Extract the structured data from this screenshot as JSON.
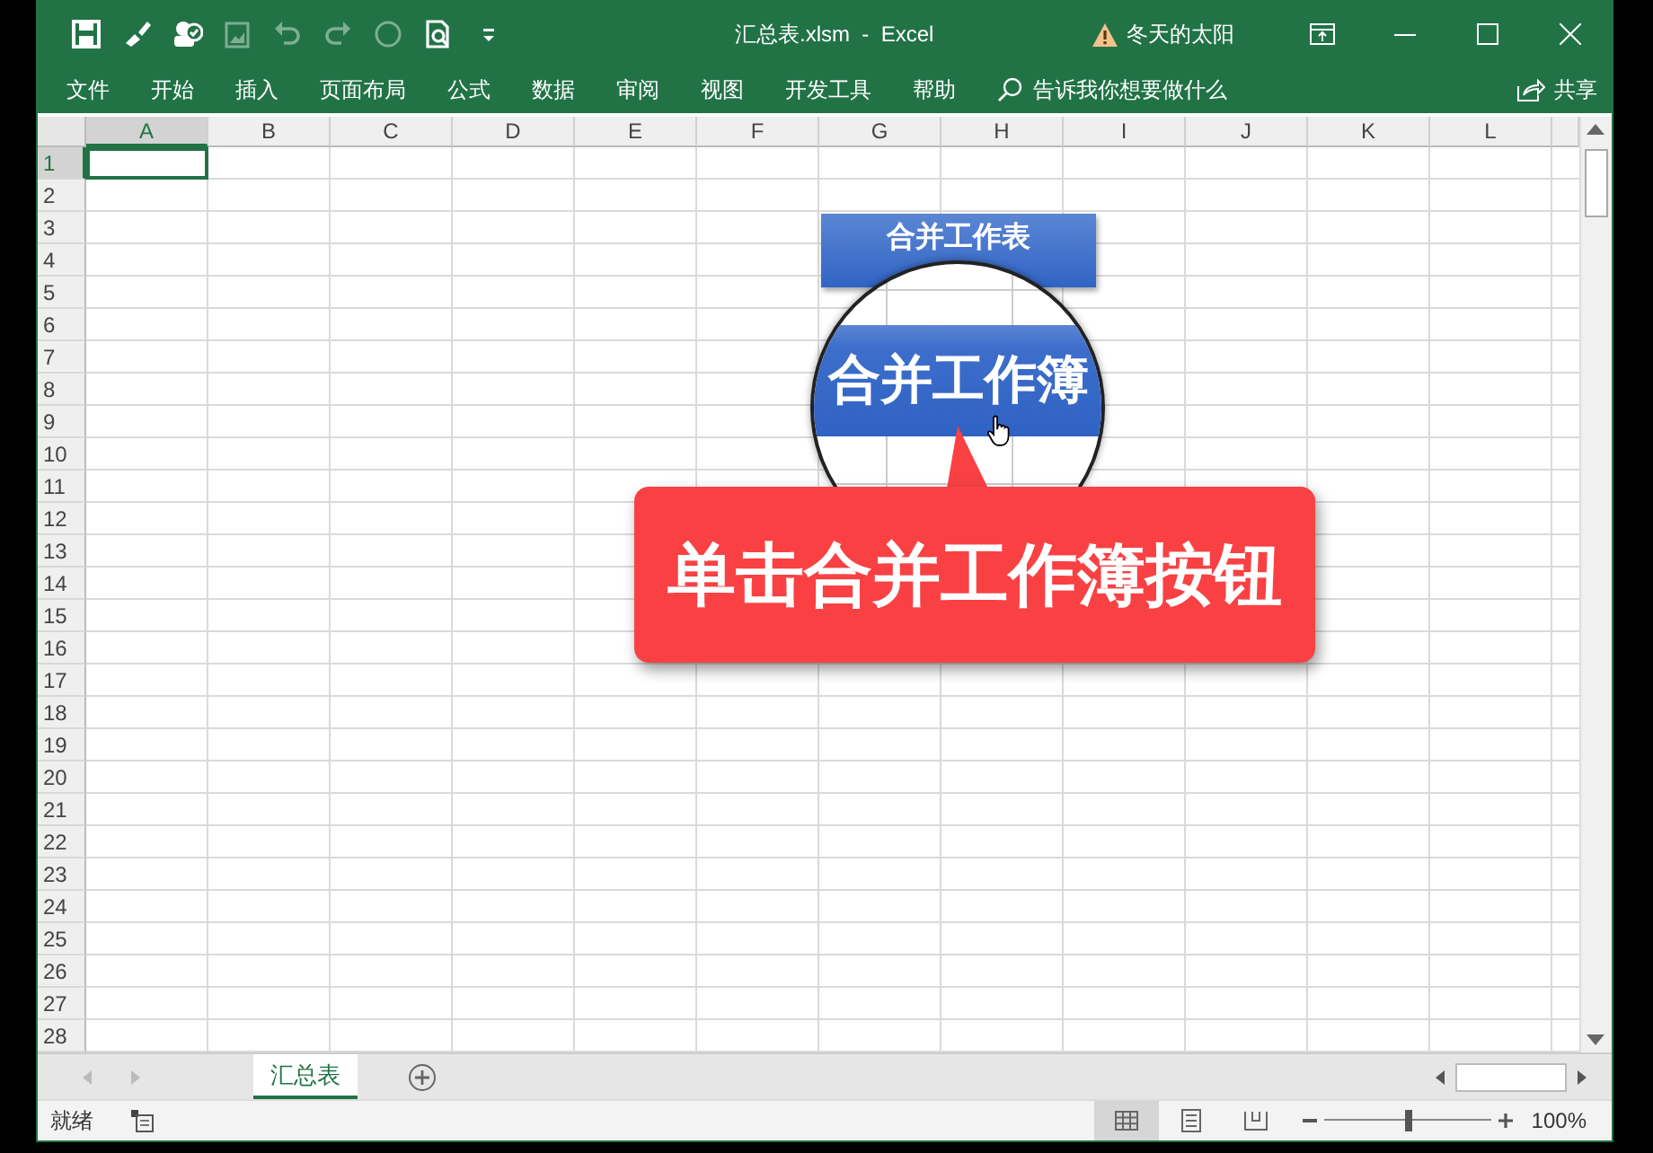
{
  "window": {
    "title": "汇总表.xlsm  -  Excel",
    "user": "冬天的太阳"
  },
  "quick_access": [
    {
      "kind": "save",
      "disabled": false
    },
    {
      "kind": "brush",
      "disabled": false
    },
    {
      "kind": "user-check",
      "disabled": false
    },
    {
      "kind": "picture",
      "disabled": true
    },
    {
      "kind": "undo",
      "disabled": true
    },
    {
      "kind": "redo",
      "disabled": true
    },
    {
      "kind": "circle",
      "disabled": true
    },
    {
      "kind": "preview",
      "disabled": false
    },
    {
      "kind": "customize",
      "disabled": false
    }
  ],
  "ribbon_tabs": [
    "文件",
    "开始",
    "插入",
    "页面布局",
    "公式",
    "数据",
    "审阅",
    "视图",
    "开发工具",
    "帮助"
  ],
  "tell_me": {
    "placeholder": "告诉我你想要做什么"
  },
  "share": "共享",
  "sheet": {
    "columns": [
      {
        "label": "A",
        "selected": true
      },
      {
        "label": "B",
        "selected": false
      },
      {
        "label": "C",
        "selected": false
      },
      {
        "label": "D",
        "selected": false
      },
      {
        "label": "E",
        "selected": false
      },
      {
        "label": "F",
        "selected": false
      },
      {
        "label": "G",
        "selected": false
      },
      {
        "label": "H",
        "selected": false
      },
      {
        "label": "I",
        "selected": false
      },
      {
        "label": "J",
        "selected": false
      },
      {
        "label": "K",
        "selected": false
      },
      {
        "label": "L",
        "selected": false
      }
    ],
    "rows": [
      {
        "label": "1",
        "selected": true
      },
      {
        "label": "2",
        "selected": false
      },
      {
        "label": "3",
        "selected": false
      },
      {
        "label": "4",
        "selected": false
      },
      {
        "label": "5",
        "selected": false
      },
      {
        "label": "6",
        "selected": false
      },
      {
        "label": "7",
        "selected": false
      },
      {
        "label": "8",
        "selected": false
      },
      {
        "label": "9",
        "selected": false
      },
      {
        "label": "10",
        "selected": false
      },
      {
        "label": "11",
        "selected": false
      },
      {
        "label": "12",
        "selected": false
      },
      {
        "label": "13",
        "selected": false
      },
      {
        "label": "14",
        "selected": false
      },
      {
        "label": "15",
        "selected": false
      },
      {
        "label": "16",
        "selected": false
      },
      {
        "label": "17",
        "selected": false
      },
      {
        "label": "18",
        "selected": false
      },
      {
        "label": "19",
        "selected": false
      },
      {
        "label": "20",
        "selected": false
      },
      {
        "label": "21",
        "selected": false
      },
      {
        "label": "22",
        "selected": false
      },
      {
        "label": "23",
        "selected": false
      },
      {
        "label": "24",
        "selected": false
      },
      {
        "label": "25",
        "selected": false
      },
      {
        "label": "26",
        "selected": false
      },
      {
        "label": "27",
        "selected": false
      },
      {
        "label": "28",
        "selected": false
      }
    ]
  },
  "overlay": {
    "button": "合并工作表",
    "magnified_button": "合并工作簿",
    "callout": "单击合并工作簿按钮"
  },
  "sheet_tabs": [
    {
      "label": "汇总表",
      "selected": true
    }
  ],
  "status_bar": {
    "text": "就绪",
    "views": [
      {
        "kind": "normal",
        "selected": true
      },
      {
        "kind": "page-layout",
        "selected": false
      },
      {
        "kind": "page-break",
        "selected": false
      }
    ],
    "zoom": {
      "level": 0.5,
      "reading": "100%"
    }
  }
}
